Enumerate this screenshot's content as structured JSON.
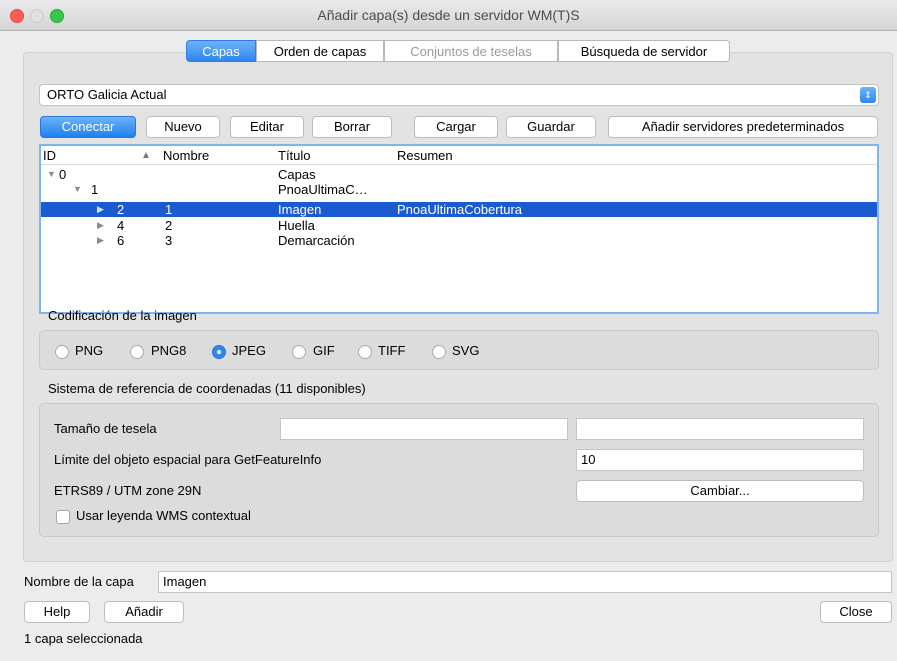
{
  "window": {
    "title": "Añadir capa(s) desde un servidor WM(T)S",
    "lights": {
      "close": "#fc5b57",
      "minimize": "#e0e0e0",
      "zoom": "#35c849"
    }
  },
  "tabs": [
    {
      "label": "Capas",
      "state": "selected"
    },
    {
      "label": "Orden de capas",
      "state": "normal"
    },
    {
      "label": "Conjuntos de teselas",
      "state": "disabled"
    },
    {
      "label": "Búsqueda de servidor",
      "state": "normal"
    }
  ],
  "server": {
    "selected": "ORTO Galicia Actual"
  },
  "buttons": {
    "connect": "Conectar",
    "new": "Nuevo",
    "edit": "Editar",
    "delete": "Borrar",
    "load": "Cargar",
    "save": "Guardar",
    "add_defaults": "Añadir servidores predeterminados"
  },
  "tree": {
    "columns": {
      "id": "ID",
      "name": "Nombre",
      "title": "Título",
      "summary": "Resumen"
    },
    "rows": [
      {
        "id": "0",
        "name": "",
        "title": "Capas",
        "summary": "",
        "expanded": true,
        "selected": false
      },
      {
        "id": "1",
        "name": "",
        "title": "PnoaUltimaC…",
        "summary": "",
        "expanded": true,
        "selected": false
      },
      {
        "id": "2",
        "name": "1",
        "title": "Imagen",
        "summary": "PnoaUltimaCobertura",
        "expanded": false,
        "selected": true
      },
      {
        "id": "4",
        "name": "2",
        "title": "Huella",
        "summary": "",
        "expanded": false,
        "selected": false
      },
      {
        "id": "6",
        "name": "3",
        "title": "Demarcación",
        "summary": "",
        "expanded": false,
        "selected": false
      }
    ]
  },
  "encoding": {
    "label": "Codificación de la imagen",
    "options": [
      "PNG",
      "PNG8",
      "JPEG",
      "GIF",
      "TIFF",
      "SVG"
    ],
    "selected": "JPEG"
  },
  "crs": {
    "label": "Sistema de referencia de coordenadas (11 disponibles)",
    "tile_size_label": "Tamaño de tesela",
    "tile_width": "",
    "tile_height": "",
    "feature_limit_label": "Límite del objeto espacial para GetFeatureInfo",
    "feature_limit_value": "10",
    "current_crs": "ETRS89 / UTM zone 29N",
    "change_button": "Cambiar...",
    "contextual_legend_label": "Usar leyenda WMS contextual",
    "contextual_legend_checked": false
  },
  "layer_name": {
    "label": "Nombre de la capa",
    "value": "Imagen"
  },
  "footer": {
    "help": "Help",
    "add": "Añadir",
    "close": "Close",
    "status": "1 capa seleccionada"
  }
}
